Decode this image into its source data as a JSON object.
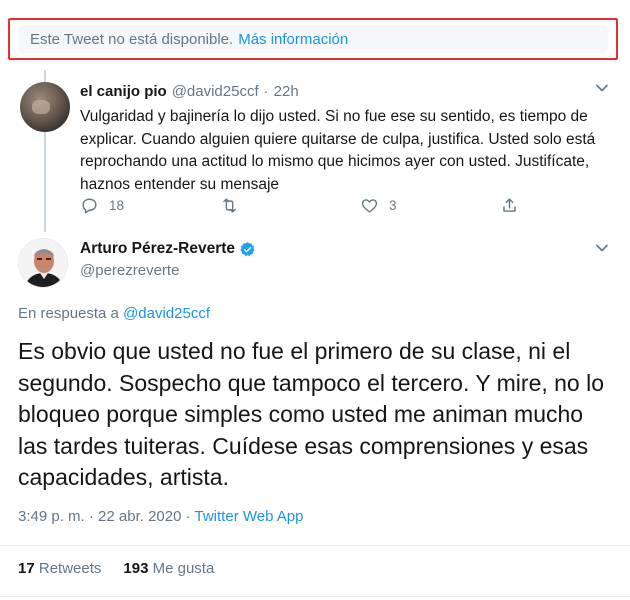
{
  "notice": {
    "text": "Este Tweet no está disponible.",
    "link": "Más información"
  },
  "reply_tweet": {
    "name": "el canijo pio",
    "handle": "@david25ccf",
    "separator": "·",
    "time": "22h",
    "text": "Vulgaridad y bajinería lo dijo usted. Si no fue ese su sentido, es tiempo de explicar. Cuando alguien quiere quitarse de culpa, justifica. Usted solo está reprochando una actitud lo mismo que hicimos ayer con usted. Justifícate, haznos entender su mensaje",
    "actions": {
      "replies": "18",
      "retweets": "",
      "likes": "3"
    }
  },
  "main_tweet": {
    "name": "Arturo Pérez-Reverte",
    "handle": "@perezreverte",
    "reply_prefix": "En respuesta a",
    "reply_to": "@david25ccf",
    "text": "Es obvio que usted no fue el primero de su clase, ni el segundo. Sospecho que tampoco el tercero. Y mire, no lo bloqueo porque simples como usted me animan mucho las tardes tuiteras. Cuídese esas comprensiones y esas capacidades, artista.",
    "timestamp": "3:49 p. m. · 22 abr. 2020 ·",
    "source": "Twitter Web App",
    "retweets_count": "17",
    "retweets_label": "Retweets",
    "likes_count": "193",
    "likes_label": "Me gusta"
  },
  "colors": {
    "accent": "#1b95e0",
    "secondary_text": "#657786",
    "highlight_border": "#e2302f"
  }
}
